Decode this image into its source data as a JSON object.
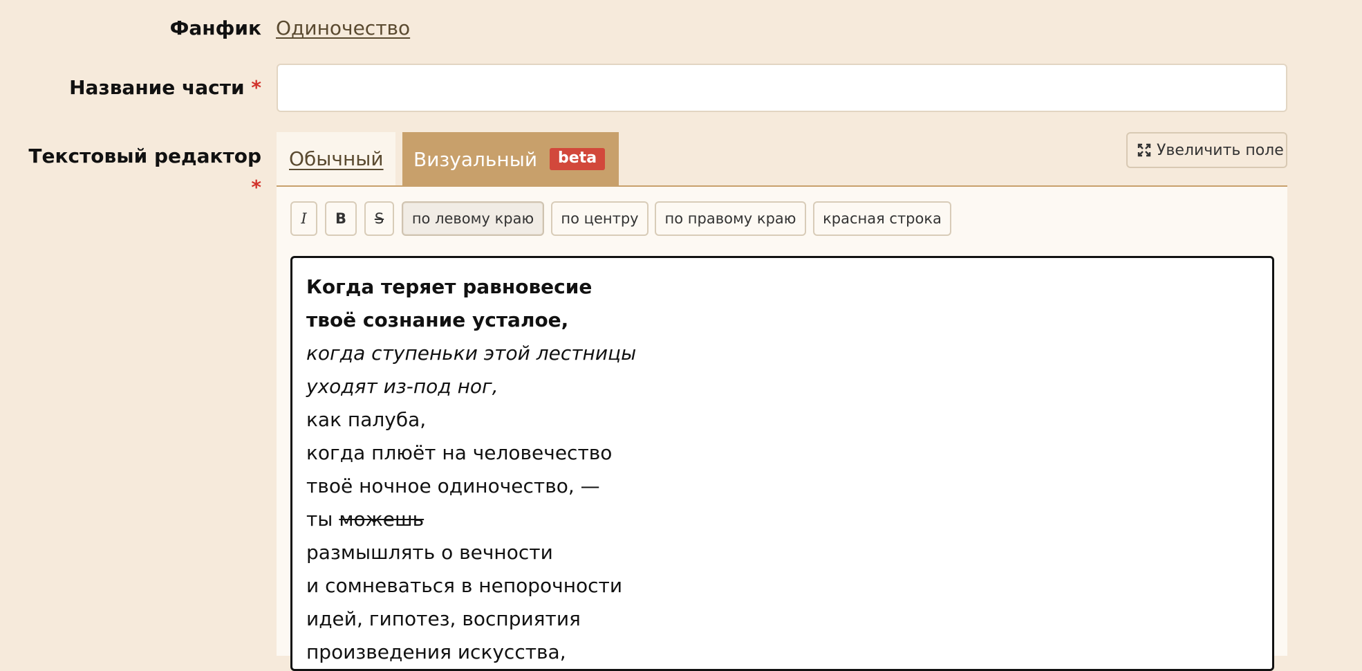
{
  "form": {
    "fanfic_label": "Фанфик",
    "fanfic_link": "Одиночество",
    "title_label": "Название части",
    "title_value": "",
    "required_mark": "*",
    "editor_label": "Текстовый редактор"
  },
  "tabs": {
    "plain": "Обычный",
    "visual": "Визуальный",
    "beta_badge": "beta"
  },
  "expand_button": "Увеличить поле",
  "toolbar": {
    "italic": "I",
    "bold": "B",
    "strike": "S",
    "align_left": "по левому краю",
    "align_center": "по центру",
    "align_right": "по правому краю",
    "red_line": "красная строка"
  },
  "content": {
    "line1": "Когда теряет равновесие",
    "line2": "твоё сознание усталое,",
    "line3": "когда ступеньки этой лестницы",
    "line4": "уходят из-под ног,",
    "line5": "как палуба,",
    "line6": "когда плюёт на человечество",
    "line7": "твоё ночное одиночество, —",
    "line8_prefix": "ты ",
    "line8_struck": "можешь",
    "line9": "размышлять о вечности",
    "line10": "и сомневаться в непорочности",
    "line11": "идей, гипотез, восприятия",
    "line12": "произведения искусства,"
  },
  "colors": {
    "page_bg": "#f6eadb",
    "accent_tab": "#c8a06b",
    "required": "#d2332c",
    "beta": "#d2483b"
  }
}
